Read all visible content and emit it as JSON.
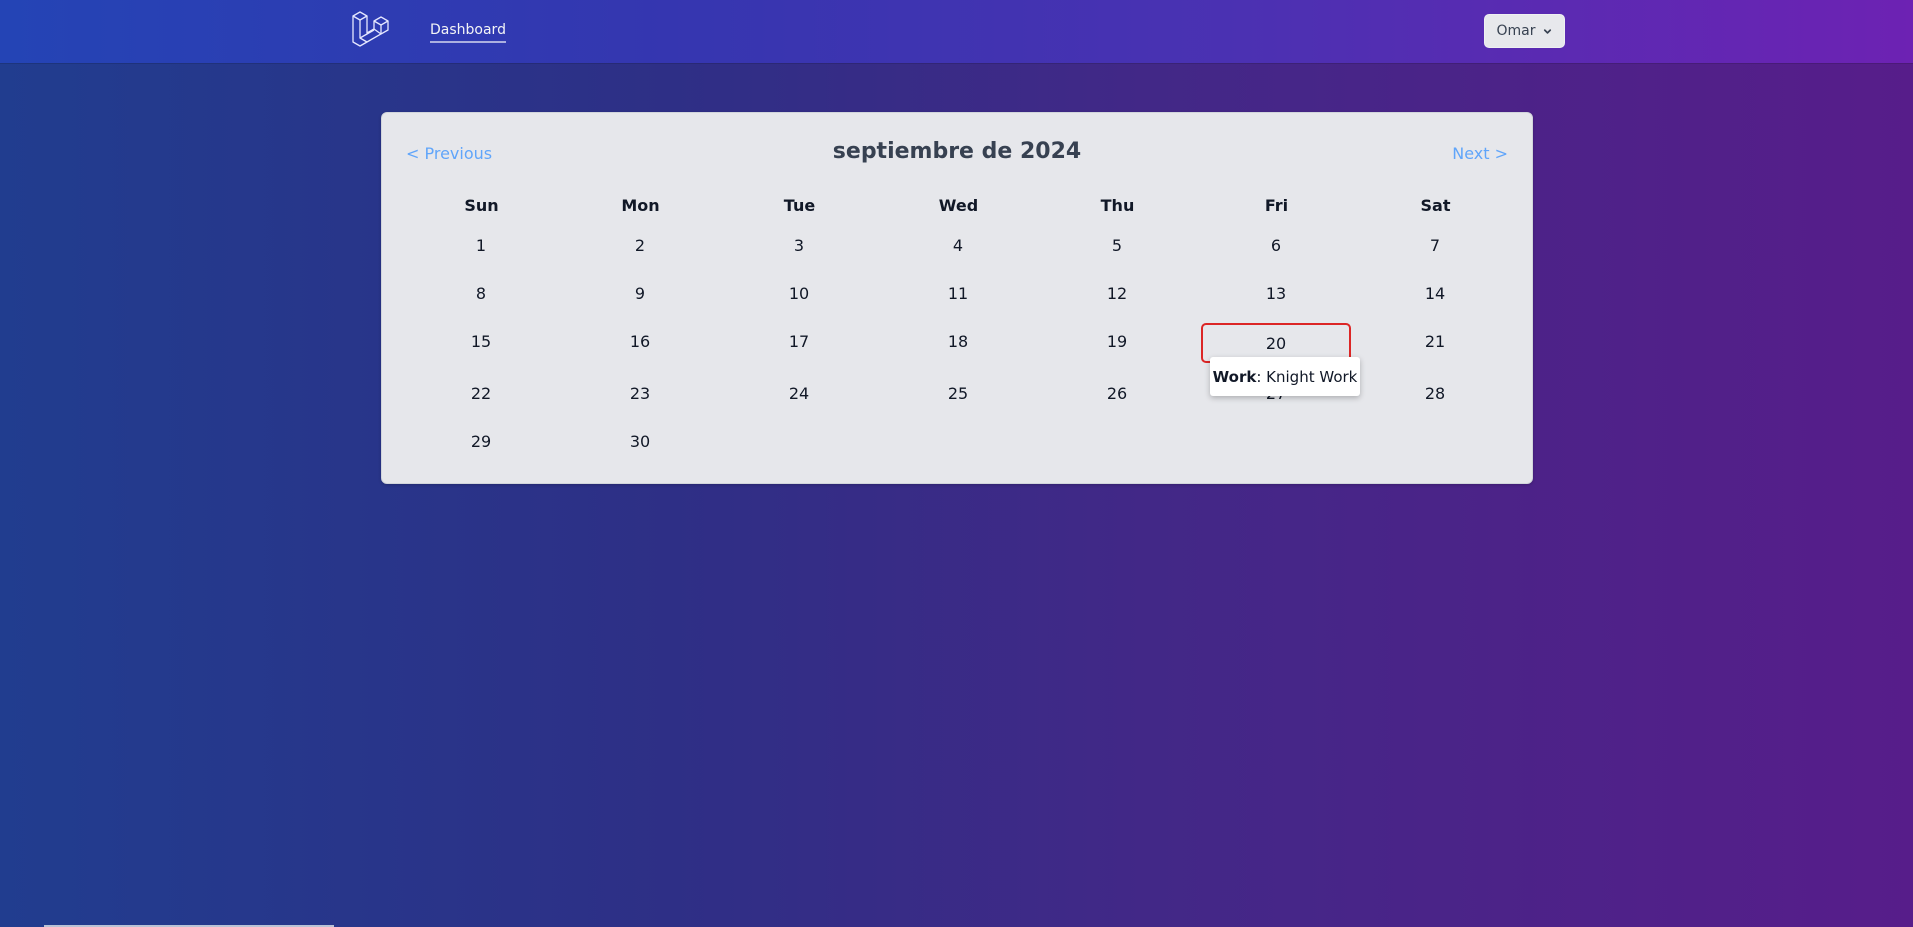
{
  "nav": {
    "logo_icon": "laravel-logo-icon",
    "dashboard_label": "Dashboard",
    "user_label": "Omar",
    "user_menu_icon": "chevron-down-icon"
  },
  "calendar": {
    "prev_label": "< Previous",
    "next_label": "Next >",
    "month_title": "septiembre de 2024",
    "weekdays": [
      "Sun",
      "Mon",
      "Tue",
      "Wed",
      "Thu",
      "Fri",
      "Sat"
    ],
    "days": [
      "1",
      "2",
      "3",
      "4",
      "5",
      "6",
      "7",
      "8",
      "9",
      "10",
      "11",
      "12",
      "13",
      "14",
      "15",
      "16",
      "17",
      "18",
      "19",
      "20",
      "21",
      "22",
      "23",
      "24",
      "25",
      "26",
      "27",
      "28",
      "29",
      "30"
    ],
    "highlighted_day": "20",
    "highlight_color": "#dc2626",
    "link_color": "#60a5fa"
  },
  "tooltip": {
    "label": "Work",
    "separator": ": ",
    "text": "Knight Work"
  }
}
